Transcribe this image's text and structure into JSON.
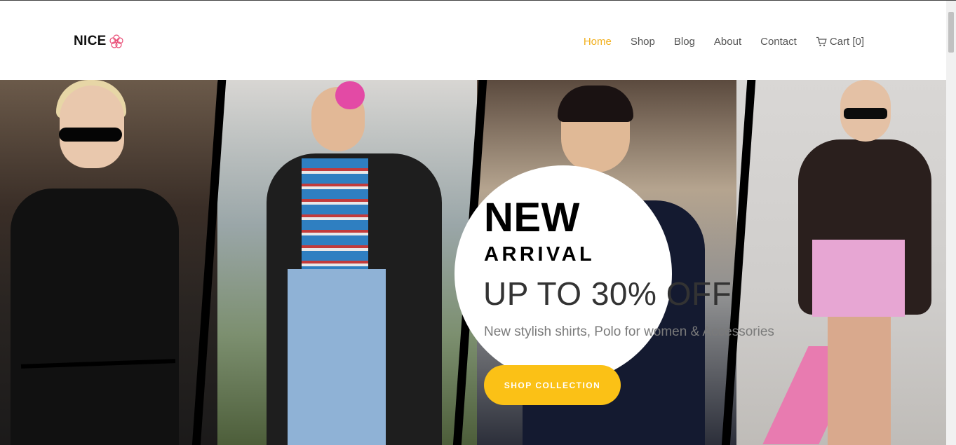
{
  "brand": {
    "name": "NICE",
    "icon": "flower-icon",
    "icon_color": "#e94e77"
  },
  "nav": {
    "items": [
      {
        "label": "Home",
        "active": true
      },
      {
        "label": "Shop",
        "active": false
      },
      {
        "label": "Blog",
        "active": false
      },
      {
        "label": "About",
        "active": false
      },
      {
        "label": "Contact",
        "active": false
      },
      {
        "label": "Cart [0]",
        "icon": "cart-icon",
        "active": false
      }
    ]
  },
  "hero": {
    "title_line1": "NEW",
    "title_line2": "ARRIVAL",
    "offer": "UP TO 30% OFF",
    "subtitle": "New stylish shirts, Polo for women & Accessories",
    "cta_label": "SHOP COLLECTION"
  },
  "colors": {
    "accent": "#f2b01e",
    "button": "#fbc116",
    "text": "#111111"
  }
}
